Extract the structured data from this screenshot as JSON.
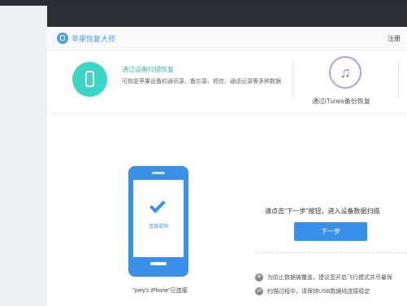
{
  "window": {
    "app_title": "苹果恢复大师",
    "register_label": "注册"
  },
  "modes": {
    "device_scan": {
      "title": "通过设备扫描恢复",
      "description": "可恢复苹果设备的通讯录、备忘录、短信、通话记录等多种数据",
      "icon": "phone-icon"
    },
    "itunes_backup": {
      "title": "通过iTunes备份恢复",
      "icon": "music-note-icon"
    }
  },
  "main": {
    "phone_status": "连接成功",
    "device_label": "\"joey's iPhone\"已连接",
    "instruction": "请点击“下一步”按钮，进入设备数据扫描",
    "next_button": "下一步",
    "tips": [
      {
        "icon": "airplane-icon",
        "text": "为防止数据被覆盖，建议您开启飞行模式并尽量保"
      },
      {
        "icon": "usb-icon",
        "text": "扫描过程中，请保持USB数据线连接稳定"
      }
    ]
  },
  "colors": {
    "accent_blue": "#3a8fe8",
    "accent_teal": "#3dd5c7",
    "accent_purple": "#9b7ad9"
  }
}
